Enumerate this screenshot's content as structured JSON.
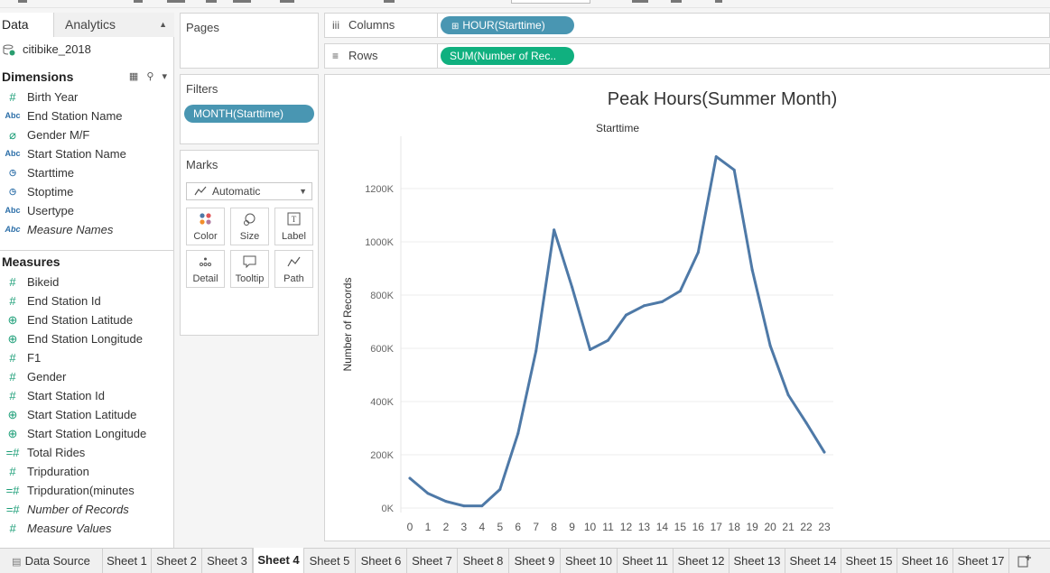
{
  "pane": {
    "tab_data": "Data",
    "tab_analytics": "Analytics",
    "datasource": "citibike_2018",
    "dimensions_title": "Dimensions",
    "dimensions": [
      {
        "label": "Birth Year",
        "icon": "#",
        "type": "number"
      },
      {
        "label": "End Station Name",
        "icon": "Abc",
        "type": "string"
      },
      {
        "label": "Gender M/F",
        "icon": "⌀",
        "type": "calc"
      },
      {
        "label": "Start Station Name",
        "icon": "Abc",
        "type": "string"
      },
      {
        "label": "Starttime",
        "icon": "◷",
        "type": "date"
      },
      {
        "label": "Stoptime",
        "icon": "◷",
        "type": "date"
      },
      {
        "label": "Usertype",
        "icon": "Abc",
        "type": "string"
      },
      {
        "label": "Measure Names",
        "icon": "Abc",
        "type": "string",
        "italic": true
      }
    ],
    "measures_title": "Measures",
    "measures": [
      {
        "label": "Bikeid",
        "icon": "#",
        "type": "number"
      },
      {
        "label": "End Station Id",
        "icon": "#",
        "type": "number"
      },
      {
        "label": "End Station Latitude",
        "icon": "⊕",
        "type": "geo"
      },
      {
        "label": "End Station Longitude",
        "icon": "⊕",
        "type": "geo"
      },
      {
        "label": "F1",
        "icon": "#",
        "type": "number"
      },
      {
        "label": "Gender",
        "icon": "#",
        "type": "number"
      },
      {
        "label": "Start Station Id",
        "icon": "#",
        "type": "number"
      },
      {
        "label": "Start Station Latitude",
        "icon": "⊕",
        "type": "geo"
      },
      {
        "label": "Start Station Longitude",
        "icon": "⊕",
        "type": "geo"
      },
      {
        "label": "Total Rides",
        "icon": "=#",
        "type": "calc"
      },
      {
        "label": "Tripduration",
        "icon": "#",
        "type": "number"
      },
      {
        "label": "Tripduration(minutes",
        "icon": "=#",
        "type": "calc"
      },
      {
        "label": "Number of Records",
        "icon": "=#",
        "type": "calc",
        "italic": true
      },
      {
        "label": "Measure Values",
        "icon": "#",
        "type": "number",
        "italic": true
      }
    ]
  },
  "cards": {
    "pages": "Pages",
    "filters": "Filters",
    "filter_pill": "MONTH(Starttime)",
    "marks": "Marks",
    "marks_type": "Automatic",
    "mark_buttons": [
      "Color",
      "Size",
      "Label",
      "Detail",
      "Tooltip",
      "Path"
    ]
  },
  "shelves": {
    "columns_label": "Columns",
    "columns_pill": "HOUR(Starttime)",
    "rows_label": "Rows",
    "rows_pill": "SUM(Number of Rec.."
  },
  "sheet_tabs": [
    "Data Source",
    "Sheet 1",
    "Sheet 2",
    "Sheet 3",
    "Sheet 4",
    "Sheet 5",
    "Sheet 6",
    "Sheet 7",
    "Sheet 8",
    "Sheet 9",
    "Sheet 10",
    "Sheet 11",
    "Sheet 12",
    "Sheet 13",
    "Sheet 14",
    "Sheet 15",
    "Sheet 16",
    "Sheet 17"
  ],
  "active_sheet": "Sheet 4",
  "colors": {
    "line": "#4e79a7",
    "pill_blue": "#4996b2",
    "pill_green": "#10b07f"
  },
  "chart_data": {
    "type": "line",
    "title": "Peak Hours(Summer Month)",
    "header": "Starttime",
    "xlabel": "",
    "ylabel": "Number of Records",
    "x": [
      0,
      1,
      2,
      3,
      4,
      5,
      6,
      7,
      8,
      9,
      10,
      11,
      12,
      13,
      14,
      15,
      16,
      17,
      18,
      19,
      20,
      21,
      22,
      23
    ],
    "values": [
      112000,
      55000,
      25000,
      8000,
      8000,
      70000,
      280000,
      590000,
      1045000,
      830000,
      595000,
      630000,
      725000,
      760000,
      775000,
      815000,
      960000,
      1320000,
      1270000,
      895000,
      610000,
      425000,
      320000,
      210000
    ],
    "y_ticks": [
      "0K",
      "200K",
      "400K",
      "600K",
      "800K",
      "1000K",
      "1200K"
    ],
    "y_tick_values": [
      0,
      200000,
      400000,
      600000,
      800000,
      1000000,
      1200000
    ],
    "ylim": [
      0,
      1350000
    ],
    "grid": true
  }
}
